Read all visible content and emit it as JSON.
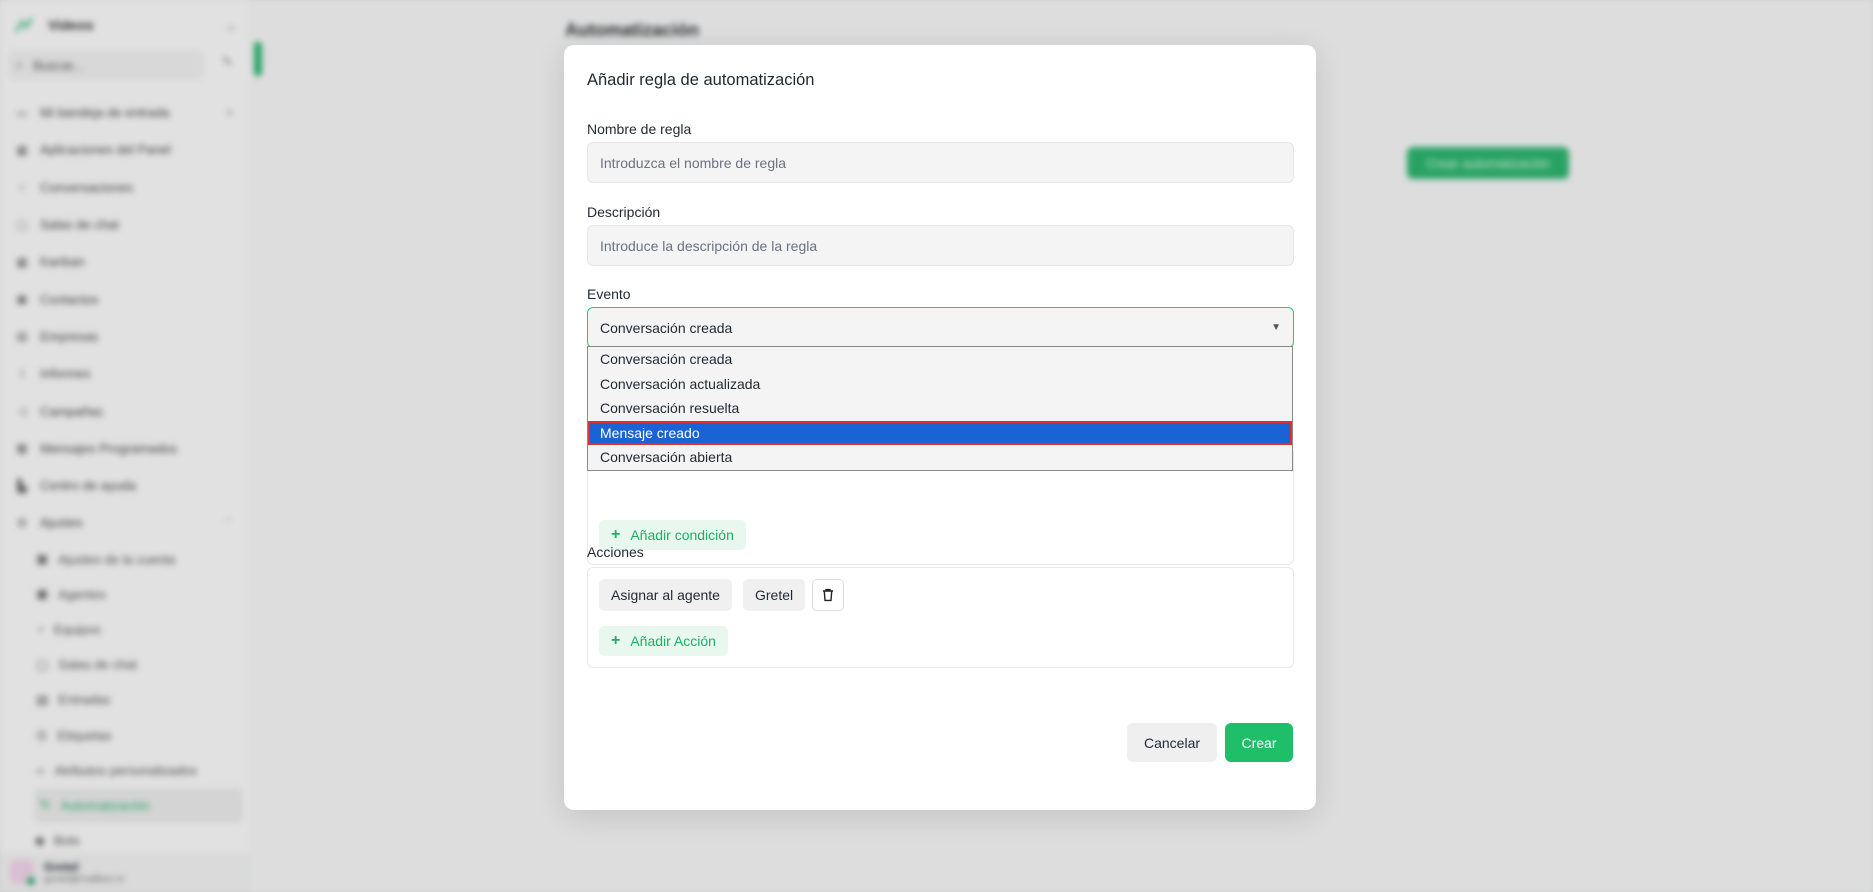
{
  "background": {
    "sidebar": {
      "app_name": "Videos",
      "search_placeholder": "Buscar...",
      "items": [
        {
          "label": "Mi bandeja de entrada",
          "icon": "inbox-icon"
        },
        {
          "label": "Aplicaciones del Panel",
          "icon": "grid-icon"
        },
        {
          "label": "Conversaciones",
          "icon": "chat-icon"
        },
        {
          "label": "Salas de chat",
          "icon": "message-icon"
        },
        {
          "label": "Kanban",
          "icon": "kanban-icon"
        },
        {
          "label": "Contactos",
          "icon": "contacts-icon"
        },
        {
          "label": "Empresas",
          "icon": "building-icon"
        },
        {
          "label": "Informes",
          "icon": "chart-icon"
        },
        {
          "label": "Campañas",
          "icon": "megaphone-icon"
        },
        {
          "label": "Mensajes Programados",
          "icon": "calendar-icon"
        },
        {
          "label": "Centro de ayuda",
          "icon": "book-icon"
        },
        {
          "label": "Ajustes",
          "icon": "gear-icon"
        }
      ],
      "settings_items": [
        {
          "label": "Ajustes de la cuenta",
          "icon": "settings-icon"
        },
        {
          "label": "Agentes",
          "icon": "agent-icon"
        },
        {
          "label": "Equipos",
          "icon": "team-icon"
        },
        {
          "label": "Salas de chat",
          "icon": "message-icon"
        },
        {
          "label": "Entradas",
          "icon": "inbox-icon"
        },
        {
          "label": "Etiquetas",
          "icon": "tag-icon"
        },
        {
          "label": "Atributos personalizados",
          "icon": "code-icon"
        },
        {
          "label": "Automatización",
          "icon": "automation-icon",
          "active": true
        },
        {
          "label": "Bots",
          "icon": "bot-icon"
        }
      ],
      "user": {
        "name": "Gretel",
        "email": "gretel@mailbox.io"
      }
    },
    "page_title": "Automatización",
    "create_button": "Crear automatización"
  },
  "modal": {
    "title": "Añadir regla de automatización",
    "rule_name": {
      "label": "Nombre de regla",
      "placeholder": "Introduzca el nombre de regla",
      "value": ""
    },
    "description": {
      "label": "Descripción",
      "placeholder": "Introduce la descripción de la regla",
      "value": ""
    },
    "event": {
      "label": "Evento",
      "selected": "Conversación creada",
      "options": [
        "Conversación creada",
        "Conversación actualizada",
        "Conversación resuelta",
        "Mensaje creado",
        "Conversación abierta"
      ],
      "highlighted_option": "Mensaje creado"
    },
    "add_condition": "Añadir condición",
    "actions": {
      "label": "Acciones",
      "action_type": "Asignar al agente",
      "action_value": "Gretel",
      "add_action": "Añadir Acción"
    },
    "cancel": "Cancelar",
    "create": "Crear",
    "accent_color": "#1fbf6a",
    "selection_color": "#1a63d4"
  }
}
